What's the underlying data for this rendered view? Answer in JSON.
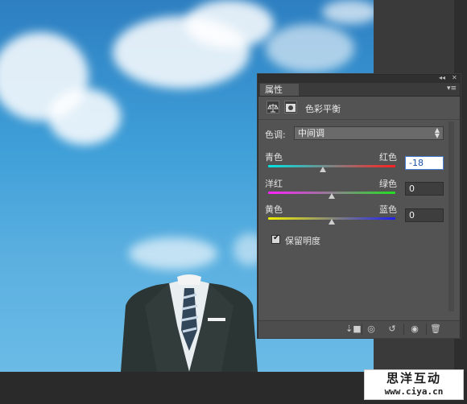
{
  "panel": {
    "tab_label": "属性",
    "header_title": "色彩平衡",
    "tone_label": "色调:",
    "tone_value": "中间调",
    "sliders": [
      {
        "left": "青色",
        "right": "红色",
        "value": "-18",
        "position": 0.43
      },
      {
        "left": "洋红",
        "right": "绿色",
        "value": "0",
        "position": 0.5
      },
      {
        "left": "黄色",
        "right": "蓝色",
        "value": "0",
        "position": 0.5
      }
    ],
    "preserve_luminosity_label": "保留明度",
    "preserve_luminosity_checked": true
  },
  "watermark": {
    "line1": "思洋互动",
    "line2": "www.ciya.cn"
  },
  "colors": {
    "panel_bg": "#535353",
    "accent": "#4a7fd6"
  },
  "icons": [
    "balance-icon",
    "mask-icon",
    "clip-icon",
    "view-previous-icon",
    "reset-icon",
    "visibility-icon",
    "delete-icon",
    "collapse-icon",
    "close-icon",
    "panel-menu-icon"
  ]
}
